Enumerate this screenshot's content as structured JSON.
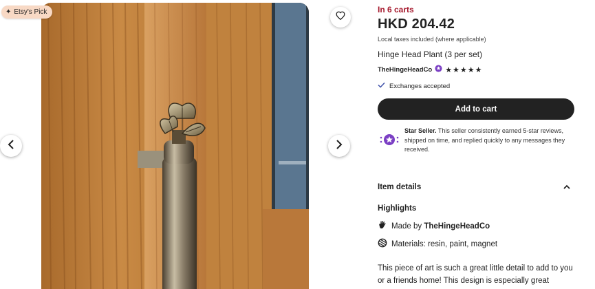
{
  "badge": {
    "label": "Etsy's Pick"
  },
  "product": {
    "carts": "In 6 carts",
    "price": "HKD 204.42",
    "taxes": "Local taxes included (where applicable)",
    "title": "Hinge Head Plant (3 per set)",
    "shop_name": "TheHingeHeadCo",
    "stars": "★★★★★",
    "rating": 5,
    "exchanges": "Exchanges accepted",
    "add_to_cart": "Add to cart"
  },
  "star_seller": {
    "label": "Star Seller.",
    "text": " This seller consistently earned 5-star reviews, shipped on time, and replied quickly to any messages they received."
  },
  "details": {
    "section_title": "Item details",
    "highlights_title": "Highlights",
    "made_by_prefix": "Made by ",
    "made_by_shop": "TheHingeHeadCo",
    "materials": "Materials: resin, paint, magnet",
    "description": "This piece of art is such a great little detail to add to you or a friends home! This design is especially great"
  },
  "colors": {
    "carts_red": "#a61a2e",
    "button_dark": "#222222",
    "badge_bg": "#f8d9c5",
    "star_seller_purple": "#7b3fc4"
  },
  "icons": {
    "favorite": "heart-icon",
    "prev": "chevron-left-icon",
    "next": "chevron-right-icon",
    "badge": "sparkle-icon",
    "verified": "star-badge-icon",
    "exchanges": "checkmark-icon",
    "star_seller": "star-seller-icon",
    "collapse": "chevron-up-icon",
    "made_by": "hand-icon",
    "materials": "materials-icon"
  }
}
